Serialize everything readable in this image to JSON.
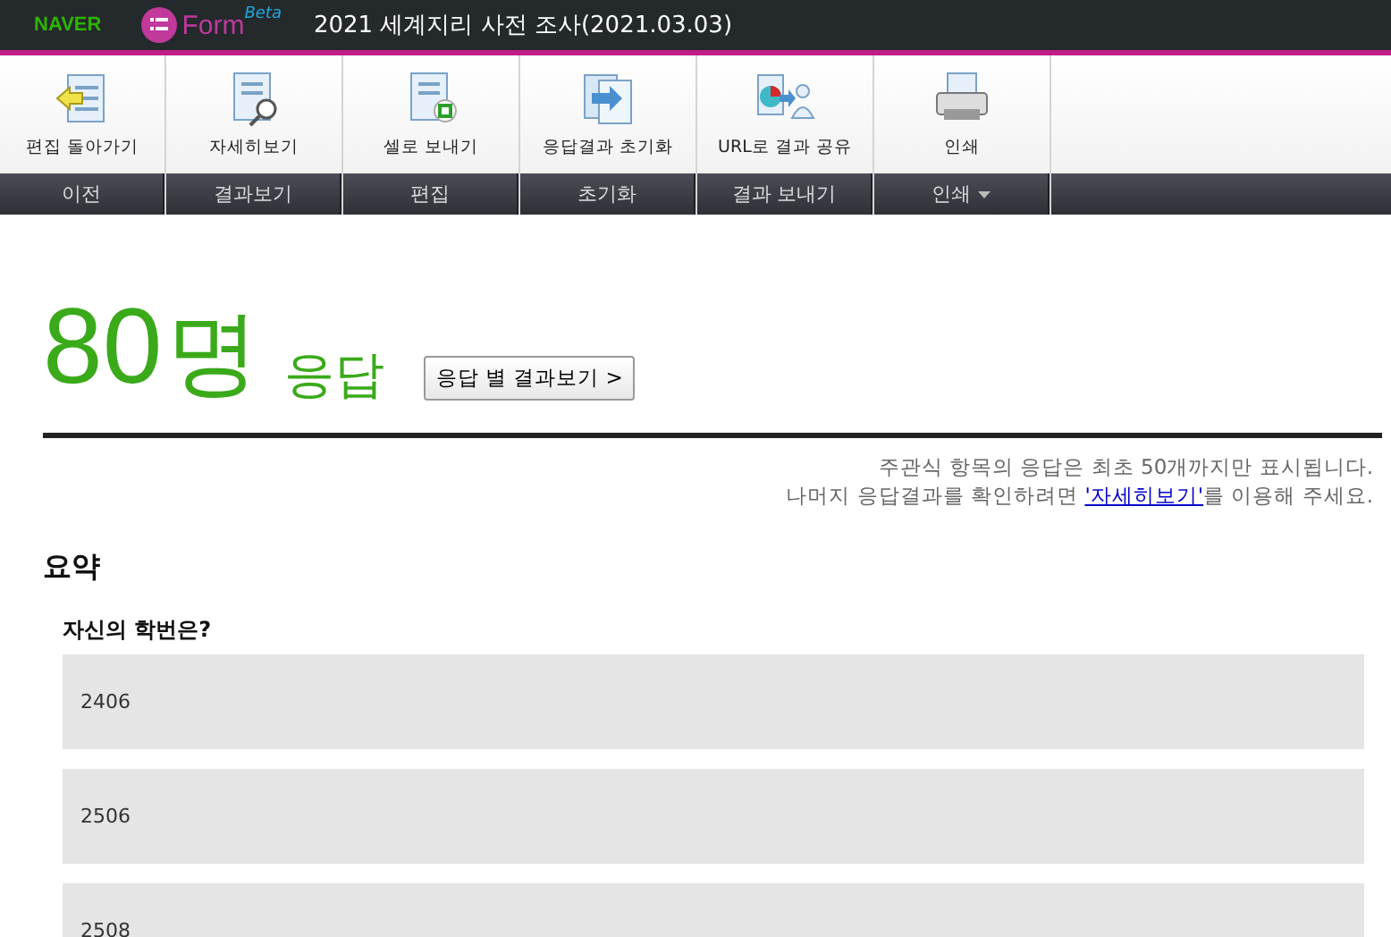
{
  "header": {
    "brand": "NAVER",
    "product": "Form",
    "product_tag": "Beta",
    "title": "2021 세계지리 사전 조사(2021.03.03)"
  },
  "toolbar": [
    {
      "group": "이전",
      "button": "편집 돌아가기",
      "has_menu": false
    },
    {
      "group": "결과보기",
      "button": "자세히보기",
      "has_menu": false
    },
    {
      "group": "편집",
      "button": "셀로 보내기",
      "has_menu": false
    },
    {
      "group": "초기화",
      "button": "응답결과 초기화",
      "has_menu": false
    },
    {
      "group": "결과 보내기",
      "button": "URL로 결과 공유",
      "has_menu": false
    },
    {
      "group": "인쇄",
      "button": "인쇄",
      "has_menu": true
    }
  ],
  "summary": {
    "count": "80",
    "unit": "명",
    "label": "응답",
    "button": "응답 별 결과보기 >"
  },
  "notice": {
    "line1": "주관식 항목의 응답은 최초 50개까지만 표시됩니다.",
    "line2_before": "나머지 응답결과를 확인하려면 ",
    "line2_link": "'자세히보기'",
    "line2_after": "를 이용해 주세요."
  },
  "section_title": "요약",
  "question": {
    "title": "자신의 학번은?",
    "answers": [
      "2406",
      "2506",
      "2508"
    ]
  }
}
